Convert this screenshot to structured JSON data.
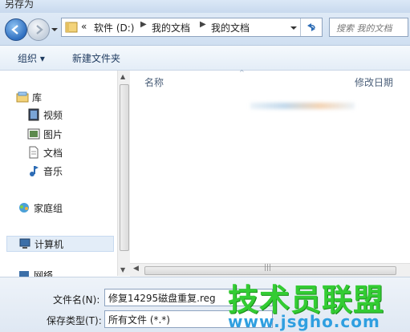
{
  "window": {
    "title": "另存为"
  },
  "address": {
    "overflow": "«",
    "segments": [
      "软件 (D:)",
      "我的文档",
      "我的文档"
    ]
  },
  "search": {
    "placeholder": "搜索 我的文档"
  },
  "toolbar": {
    "organize_label": "组织 ▾",
    "new_folder_label": "新建文件夹"
  },
  "sidebar": {
    "items": [
      {
        "label": "库",
        "icon": "library-icon"
      },
      {
        "label": "视频",
        "icon": "video-icon"
      },
      {
        "label": "图片",
        "icon": "picture-icon"
      },
      {
        "label": "文档",
        "icon": "document-icon"
      },
      {
        "label": "音乐",
        "icon": "music-icon"
      },
      {
        "label": "家庭组",
        "icon": "homegroup-icon"
      },
      {
        "label": "计算机",
        "icon": "computer-icon"
      },
      {
        "label": "网络",
        "icon": "network-icon"
      }
    ]
  },
  "columns": {
    "name": "名称",
    "modified": "修改日期"
  },
  "form": {
    "filename_label": "文件名(N):",
    "filename_value": "修复14295磁盘重复.reg",
    "filetype_label": "保存类型(T):",
    "filetype_value": "所有文件  (*.*)"
  },
  "watermark": {
    "text": "技术员联盟",
    "url": "www.jsgho.com"
  },
  "colors": {
    "accent": "#2f6fc0",
    "watermark_green": "#33cc33",
    "watermark_blue": "#2f9fe0"
  }
}
